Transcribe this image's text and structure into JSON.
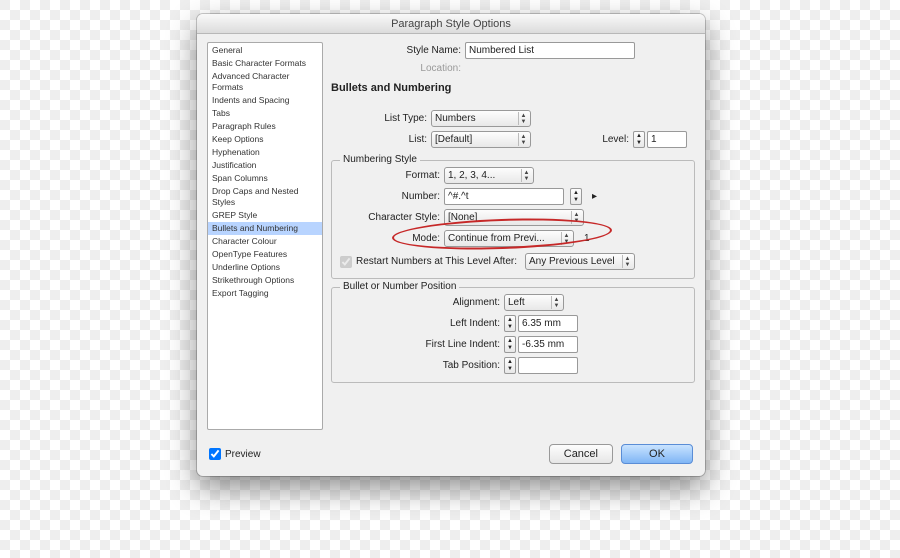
{
  "dialog": {
    "title": "Paragraph Style Options"
  },
  "sidebar": {
    "items": [
      "General",
      "Basic Character Formats",
      "Advanced Character Formats",
      "Indents and Spacing",
      "Tabs",
      "Paragraph Rules",
      "Keep Options",
      "Hyphenation",
      "Justification",
      "Span Columns",
      "Drop Caps and Nested Styles",
      "GREP Style",
      "Bullets and Numbering",
      "Character Colour",
      "OpenType Features",
      "Underline Options",
      "Strikethrough Options",
      "Export Tagging"
    ],
    "selected": 12
  },
  "header": {
    "style_name_label": "Style Name:",
    "style_name": "Numbered List",
    "location_label": "Location:"
  },
  "panel": {
    "title": "Bullets and Numbering",
    "list_type_label": "List Type:",
    "list_type": "Numbers",
    "list_label": "List:",
    "list": "[Default]",
    "level_label": "Level:",
    "level": "1",
    "numbering_style_legend": "Numbering Style",
    "format_label": "Format:",
    "format": "1, 2, 3, 4...",
    "number_label": "Number:",
    "number": "^#.^t",
    "char_style_label": "Character Style:",
    "char_style": "[None]",
    "mode_label": "Mode:",
    "mode": "Continue from Previ...",
    "mode_value": "1",
    "restart_label": "Restart Numbers at This Level After:",
    "restart_value": "Any Previous Level",
    "position_legend": "Bullet or Number Position",
    "alignment_label": "Alignment:",
    "alignment": "Left",
    "left_indent_label": "Left Indent:",
    "left_indent": "6.35 mm",
    "first_line_label": "First Line Indent:",
    "first_line": "-6.35 mm",
    "tab_pos_label": "Tab Position:",
    "tab_pos": ""
  },
  "footer": {
    "preview": "Preview",
    "cancel": "Cancel",
    "ok": "OK"
  }
}
